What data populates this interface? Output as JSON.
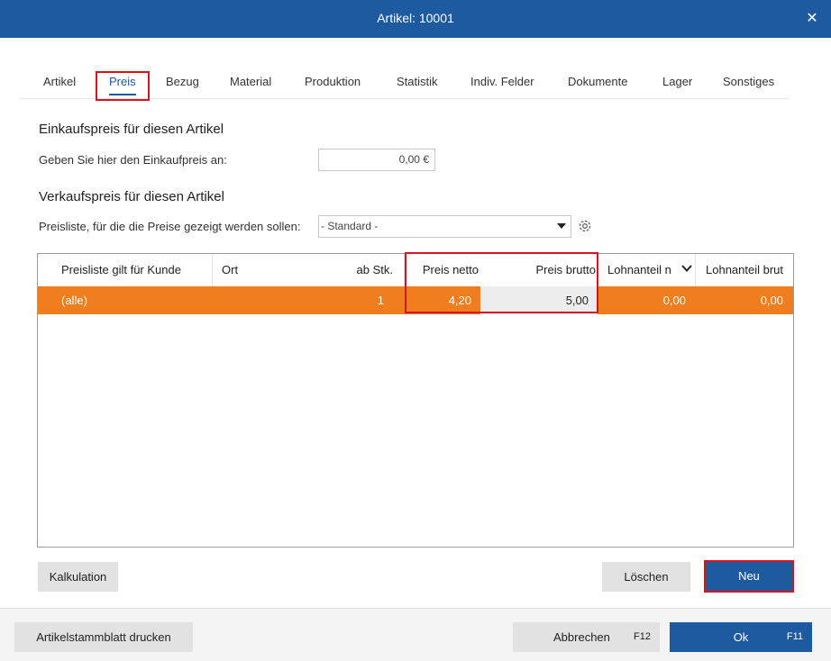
{
  "window": {
    "title": "Artikel: 10001",
    "close_glyph": "✕"
  },
  "tabs": [
    {
      "label": "Artikel"
    },
    {
      "label": "Preis"
    },
    {
      "label": "Bezug"
    },
    {
      "label": "Material"
    },
    {
      "label": "Produktion"
    },
    {
      "label": "Statistik"
    },
    {
      "label": "Indiv. Felder"
    },
    {
      "label": "Dokumente"
    },
    {
      "label": "Lager"
    },
    {
      "label": "Sonstiges"
    }
  ],
  "active_tab": "Preis",
  "einkauf": {
    "heading": "Einkaufspreis für diesen Artikel",
    "label": "Geben Sie hier den Einkaufpreis an:",
    "value": "0,00 €"
  },
  "verkauf": {
    "heading": "Verkaufspreis für diesen Artikel",
    "label": "Preisliste, für die die Preise gezeigt werden sollen:",
    "select_value": "- Standard -"
  },
  "grid": {
    "columns": [
      "Preisliste gilt für Kunde",
      "Ort",
      "ab Stk.",
      "Preis netto",
      "Preis brutto",
      "Lohnanteil n",
      "Lohnanteil brut"
    ],
    "rows": [
      {
        "kunde": "(alle)",
        "ort": "",
        "ab_stk": "1",
        "preis_netto": "4,20",
        "preis_brutto": "5,00",
        "lohn_netto": "0,00",
        "lohn_brutto": "0,00"
      }
    ]
  },
  "buttons": {
    "kalkulation": "Kalkulation",
    "loeschen": "Löschen",
    "neu": "Neu",
    "drucken": "Artikelstammblatt drucken",
    "abbrechen": "Abbrechen",
    "abbrechen_key": "F12",
    "ok": "Ok",
    "ok_key": "F11"
  },
  "colors": {
    "accent": "#1e5aa0",
    "selected_row": "#f07d1e",
    "highlight": "#d7141e"
  }
}
